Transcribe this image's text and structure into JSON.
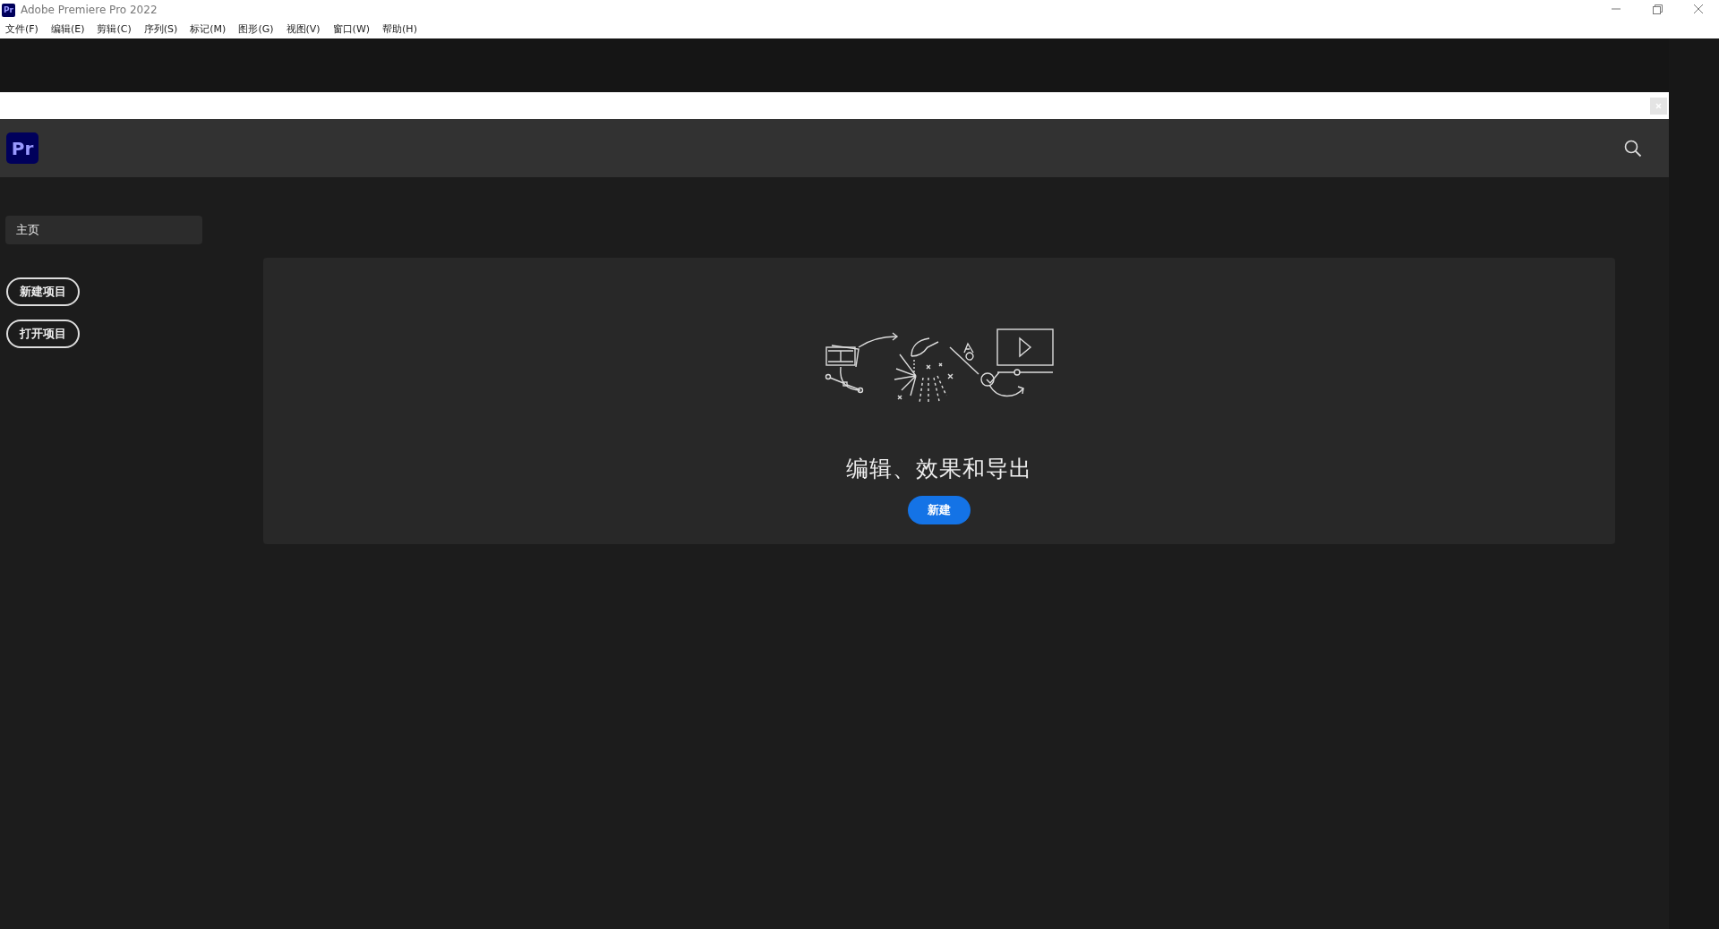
{
  "window": {
    "logo": "Pr",
    "title": "Adobe Premiere Pro 2022"
  },
  "menu": [
    "文件(F)",
    "编辑(E)",
    "剪辑(C)",
    "序列(S)",
    "标记(M)",
    "图形(G)",
    "视图(V)",
    "窗口(W)",
    "帮助(H)"
  ],
  "header": {
    "logo": "Pr"
  },
  "sidebar": {
    "items": [
      {
        "label": "主页",
        "selected": true
      }
    ],
    "buttons": [
      "新建项目",
      "打开项目"
    ]
  },
  "hero": {
    "title": "编辑、效果和导出",
    "button": "新建"
  }
}
